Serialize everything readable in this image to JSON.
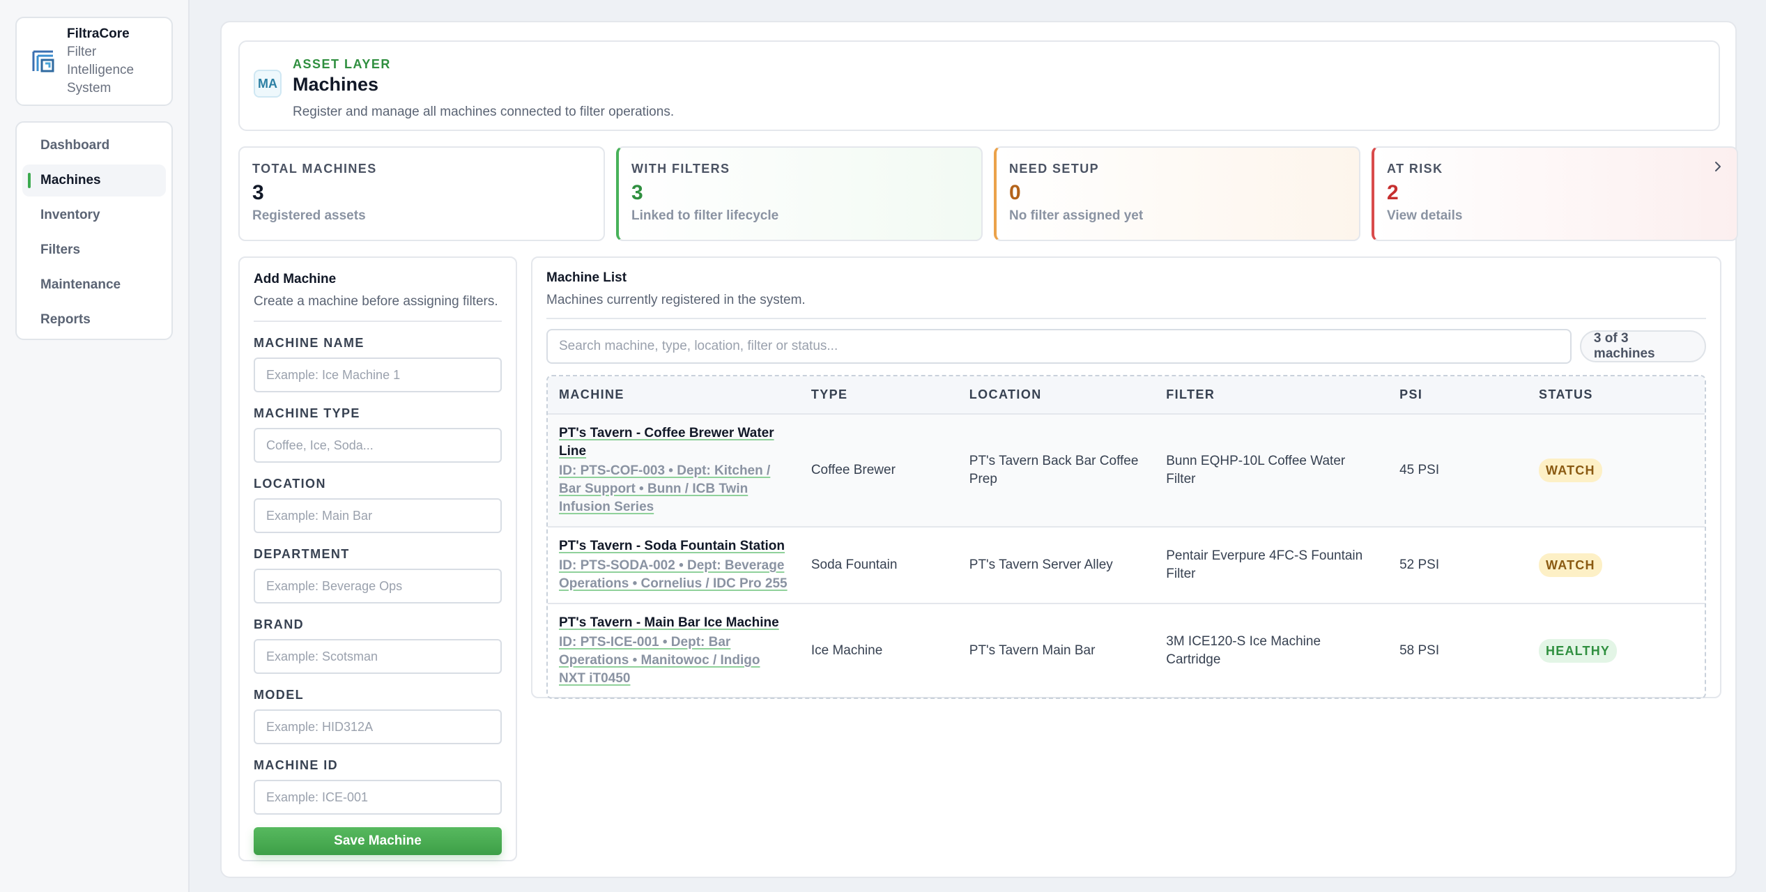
{
  "brand": {
    "name": "FiltraCore",
    "subtitle_lines": [
      "Filter",
      "Intelligence",
      "System"
    ]
  },
  "nav": [
    {
      "label": "Dashboard",
      "active": false
    },
    {
      "label": "Machines",
      "active": true
    },
    {
      "label": "Inventory",
      "active": false
    },
    {
      "label": "Filters",
      "active": false
    },
    {
      "label": "Maintenance",
      "active": false
    },
    {
      "label": "Reports",
      "active": false
    }
  ],
  "header": {
    "badge": "MA",
    "eyebrow": "ASSET LAYER",
    "title": "Machines",
    "description": "Register and manage all machines connected to filter operations."
  },
  "stats": {
    "total": {
      "label": "TOTAL MACHINES",
      "value": "3",
      "caption": "Registered assets"
    },
    "filters": {
      "label": "WITH FILTERS",
      "value": "3",
      "caption": "Linked to filter lifecycle"
    },
    "setup": {
      "label": "NEED SETUP",
      "value": "0",
      "caption": "No filter assigned yet"
    },
    "risk": {
      "label": "AT RISK",
      "value": "2",
      "caption": "View details"
    }
  },
  "form": {
    "title": "Add Machine",
    "description": "Create a machine before assigning filters.",
    "fields": [
      {
        "label": "MACHINE NAME",
        "placeholder": "Example: Ice Machine 1"
      },
      {
        "label": "MACHINE TYPE",
        "placeholder": "Coffee, Ice, Soda..."
      },
      {
        "label": "LOCATION",
        "placeholder": "Example: Main Bar"
      },
      {
        "label": "DEPARTMENT",
        "placeholder": "Example: Beverage Ops"
      },
      {
        "label": "BRAND",
        "placeholder": "Example: Scotsman"
      },
      {
        "label": "MODEL",
        "placeholder": "Example: HID312A"
      },
      {
        "label": "MACHINE ID",
        "placeholder": "Example: ICE-001"
      }
    ],
    "save_label": "Save Machine"
  },
  "list": {
    "title": "Machine List",
    "description": "Machines currently registered in the system.",
    "search_placeholder": "Search machine, type, location, filter or status...",
    "count": "3 of 3 machines",
    "columns": [
      "MACHINE",
      "TYPE",
      "LOCATION",
      "FILTER",
      "PSI",
      "STATUS"
    ],
    "rows": [
      {
        "name": "PT's Tavern - Coffee Brewer Water Line",
        "meta": "ID: PTS-COF-003 • Dept: Kitchen / Bar Support • Bunn / ICB Twin Infusion Series",
        "type": "Coffee Brewer",
        "location": "PT's Tavern Back Bar Coffee Prep",
        "filter": "Bunn EQHP-10L Coffee Water Filter",
        "psi": "45 PSI",
        "status": "WATCH"
      },
      {
        "name": "PT's Tavern - Soda Fountain Station",
        "meta": "ID: PTS-SODA-002 • Dept: Beverage Operations • Cornelius / IDC Pro 255",
        "type": "Soda Fountain",
        "location": "PT's Tavern Server Alley",
        "filter": "Pentair Everpure 4FC-S Fountain Filter",
        "psi": "52 PSI",
        "status": "WATCH"
      },
      {
        "name": "PT's Tavern - Main Bar Ice Machine",
        "meta": "ID: PTS-ICE-001 • Dept: Bar Operations • Manitowoc / Indigo NXT iT0450",
        "type": "Ice Machine",
        "location": "PT's Tavern Main Bar",
        "filter": "3M ICE120-S Ice Machine Cartridge",
        "psi": "58 PSI",
        "status": "HEALTHY"
      }
    ]
  },
  "colors": {
    "accent_green": "#3daa4f",
    "watch_bg": "#fdf0c6",
    "healthy_bg": "#e3f5e6",
    "risk_red": "#c62f2f",
    "setup_orange": "#b4631a"
  },
  "icons": {
    "brand": "filtracore-logo-icon",
    "risk_link": "chevron-right-icon"
  }
}
